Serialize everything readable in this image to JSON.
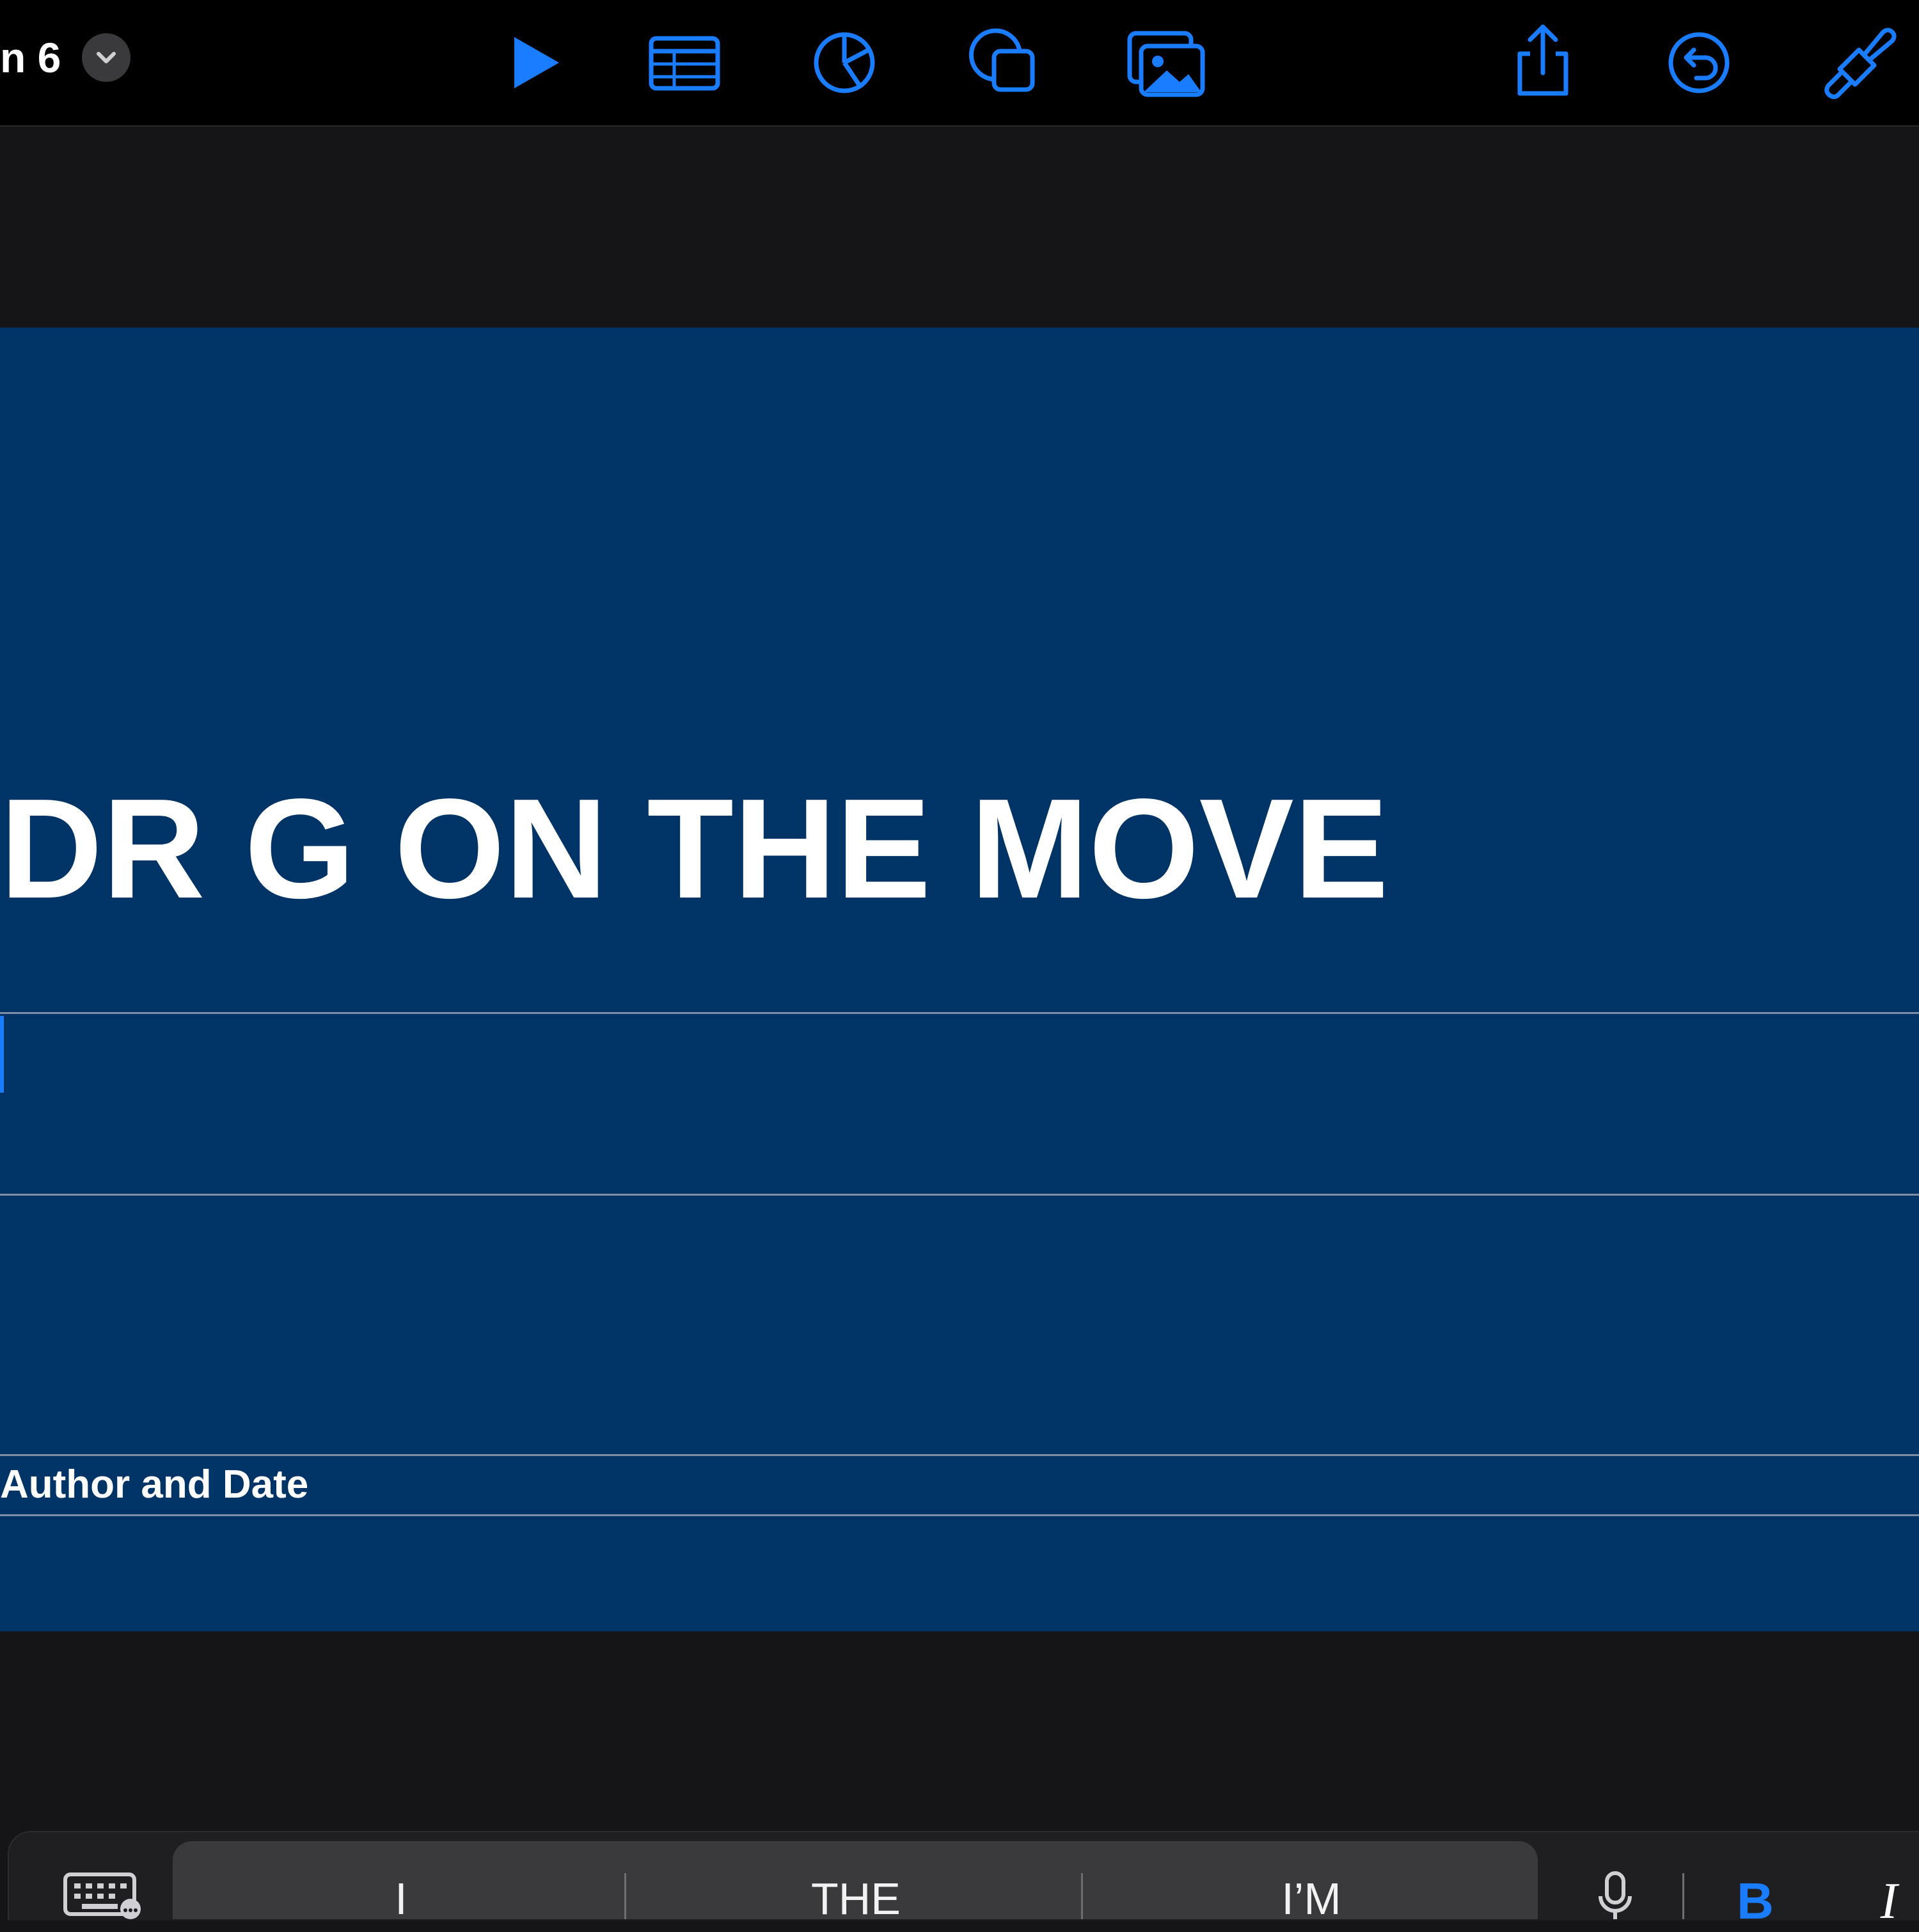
{
  "toolbar": {
    "document_title": "n 6",
    "icons": [
      "chevron-down-icon",
      "play-icon",
      "table-icon",
      "chart-icon",
      "shapes-icon",
      "media-icon",
      "share-icon",
      "undo-icon",
      "format-brush-icon"
    ],
    "accent_color": "#1a7cff"
  },
  "slide": {
    "background_color": "#003366",
    "title": "DR G ON THE MOVE",
    "subtitle": "",
    "author_date": "Author and Date"
  },
  "keyboard_bar": {
    "suggestions": [
      "I",
      "THE",
      "I’M"
    ],
    "bold_label": "B",
    "italic_label": "I",
    "icons": [
      "keyboard-icon",
      "microphone-icon"
    ]
  }
}
